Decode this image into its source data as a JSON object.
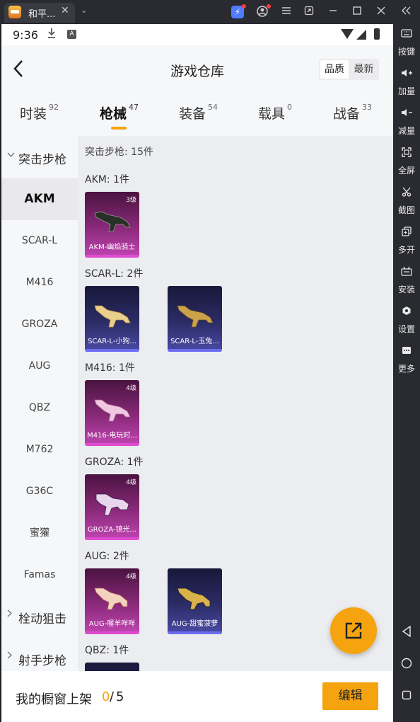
{
  "window": {
    "tab_title": "和平...",
    "close_glyph": "✕",
    "expand_glyph": "⌄"
  },
  "toolbar": {
    "items": [
      {
        "label": "按键",
        "icon": "keyboard-icon"
      },
      {
        "label": "加量",
        "icon": "volume-up-icon"
      },
      {
        "label": "减量",
        "icon": "volume-down-icon"
      },
      {
        "label": "全屏",
        "icon": "fullscreen-icon"
      },
      {
        "label": "截图",
        "icon": "scissors-icon"
      },
      {
        "label": "多开",
        "icon": "multi-instance-icon"
      },
      {
        "label": "安装",
        "icon": "apk-install-icon"
      },
      {
        "label": "设置",
        "icon": "settings-icon"
      },
      {
        "label": "更多",
        "icon": "more-icon"
      }
    ]
  },
  "status": {
    "time": "9:36",
    "badge": "A"
  },
  "header": {
    "title": "游戏仓库",
    "sort_quality": "品质",
    "sort_latest": "最新"
  },
  "tabs": [
    {
      "label": "时装",
      "count": "92"
    },
    {
      "label": "枪械",
      "count": "47"
    },
    {
      "label": "装备",
      "count": "54"
    },
    {
      "label": "载具",
      "count": "0"
    },
    {
      "label": "战备",
      "count": "33"
    }
  ],
  "sidebar": {
    "group_assault": "突击步枪",
    "items": [
      "AKM",
      "SCAR-L",
      "M416",
      "GROZA",
      "AUG",
      "QBZ",
      "M762",
      "G36C",
      "蜜獾",
      "Famas"
    ],
    "group_bolt": "栓动狙击",
    "group_marksman": "射手步枪"
  },
  "content": {
    "summary": "突击步枪: 15件",
    "sections": [
      {
        "title": "AKM: 1件",
        "cards": [
          {
            "name": "AKM-幽焰骑士",
            "level": "3级",
            "rarity": "purple"
          }
        ]
      },
      {
        "title": "SCAR-L: 2件",
        "cards": [
          {
            "name": "SCAR-L-小狗...",
            "level": "",
            "rarity": "blue"
          },
          {
            "name": "SCAR-L-玉兔...",
            "level": "",
            "rarity": "blue"
          }
        ]
      },
      {
        "title": "M416: 1件",
        "cards": [
          {
            "name": "M416-电玩时...",
            "level": "4级",
            "rarity": "purple"
          }
        ]
      },
      {
        "title": "GROZA: 1件",
        "cards": [
          {
            "name": "GROZA-镜光...",
            "level": "4级",
            "rarity": "purple"
          }
        ]
      },
      {
        "title": "AUG: 2件",
        "cards": [
          {
            "name": "AUG-喔羊咩咩",
            "level": "4级",
            "rarity": "purple"
          },
          {
            "name": "AUG-甜蜜菠萝",
            "level": "",
            "rarity": "blue"
          }
        ]
      },
      {
        "title": "QBZ: 1件"
      }
    ]
  },
  "bottom": {
    "label": "我的橱窗上架",
    "current": "0",
    "separator": "/",
    "max": "5",
    "edit_label": "编辑"
  },
  "colors": {
    "accent": "#f5a30f",
    "epic": "#c145b2",
    "rare": "#4a4aa6"
  }
}
